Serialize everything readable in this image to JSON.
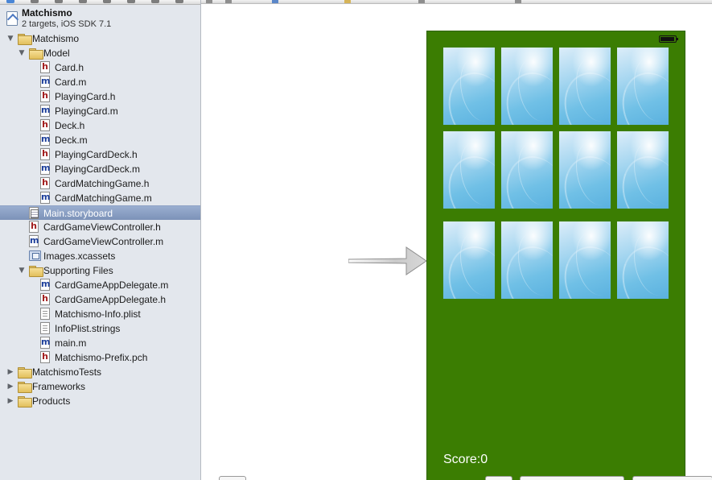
{
  "project": {
    "name": "Matchismo",
    "subtitle": "2 targets, iOS SDK 7.1"
  },
  "tree": [
    {
      "label": "Matchismo",
      "type": "folder",
      "depth": 0,
      "disclosure": "open"
    },
    {
      "label": "Model",
      "type": "folder",
      "depth": 1,
      "disclosure": "open"
    },
    {
      "label": "Card.h",
      "type": "h",
      "depth": 2
    },
    {
      "label": "Card.m",
      "type": "m",
      "depth": 2
    },
    {
      "label": "PlayingCard.h",
      "type": "h",
      "depth": 2
    },
    {
      "label": "PlayingCard.m",
      "type": "m",
      "depth": 2
    },
    {
      "label": "Deck.h",
      "type": "h",
      "depth": 2
    },
    {
      "label": "Deck.m",
      "type": "m",
      "depth": 2
    },
    {
      "label": "PlayingCardDeck.h",
      "type": "h",
      "depth": 2
    },
    {
      "label": "PlayingCardDeck.m",
      "type": "m",
      "depth": 2
    },
    {
      "label": "CardMatchingGame.h",
      "type": "h",
      "depth": 2
    },
    {
      "label": "CardMatchingGame.m",
      "type": "m",
      "depth": 2
    },
    {
      "label": "Main.storyboard",
      "type": "storyboard",
      "depth": 1,
      "selected": true
    },
    {
      "label": "CardGameViewController.h",
      "type": "h",
      "depth": 1
    },
    {
      "label": "CardGameViewController.m",
      "type": "m",
      "depth": 1
    },
    {
      "label": "Images.xcassets",
      "type": "assets",
      "depth": 1
    },
    {
      "label": "Supporting Files",
      "type": "folder",
      "depth": 1,
      "disclosure": "open"
    },
    {
      "label": "CardGameAppDelegate.m",
      "type": "m",
      "depth": 2
    },
    {
      "label": "CardGameAppDelegate.h",
      "type": "h",
      "depth": 2
    },
    {
      "label": "Matchismo-Info.plist",
      "type": "doc",
      "depth": 2
    },
    {
      "label": "InfoPlist.strings",
      "type": "doc",
      "depth": 2
    },
    {
      "label": "main.m",
      "type": "m",
      "depth": 2
    },
    {
      "label": "Matchismo-Prefix.pch",
      "type": "h",
      "depth": 2
    },
    {
      "label": "MatchismoTests",
      "type": "folder",
      "depth": 0,
      "disclosure": "closed"
    },
    {
      "label": "Frameworks",
      "type": "folder",
      "depth": 0,
      "disclosure": "closed"
    },
    {
      "label": "Products",
      "type": "folder",
      "depth": 0,
      "disclosure": "closed"
    }
  ],
  "scene": {
    "background_color": "#3b7d02",
    "score_label": "Score:0",
    "card_rows": 3,
    "card_cols": 4,
    "card_count": 12
  },
  "icons": {
    "disclosure_open": "▼",
    "disclosure_closed": "▶",
    "file_h": "h",
    "file_m": "m"
  }
}
